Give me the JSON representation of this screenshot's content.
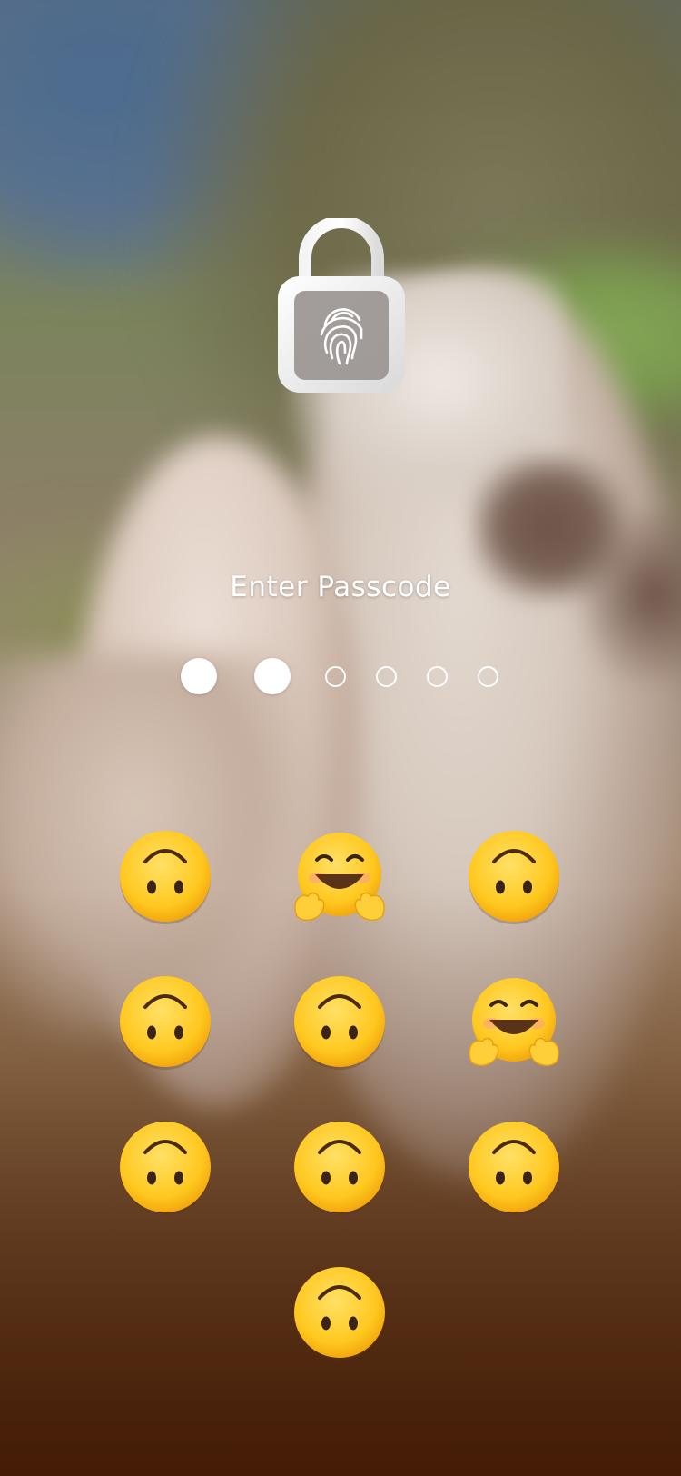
{
  "screen": {
    "title": "Enter Passcode"
  },
  "lock": {
    "icon": "fingerprint-unlocked-padlock-icon",
    "state": "unlocked"
  },
  "passcode": {
    "length": 6,
    "entered": 2
  },
  "keypad": {
    "keys": [
      {
        "emoji": "upside-down-face"
      },
      {
        "emoji": "hugging-face"
      },
      {
        "emoji": "upside-down-face"
      },
      {
        "emoji": "upside-down-face"
      },
      {
        "emoji": "upside-down-face"
      },
      {
        "emoji": "hugging-face"
      },
      {
        "emoji": "upside-down-face"
      },
      {
        "emoji": "upside-down-face"
      },
      {
        "emoji": "upside-down-face"
      },
      {
        "emoji": "upside-down-face"
      }
    ]
  },
  "colors": {
    "indicator": "#ffffff",
    "emoji_face": "#ffcc33"
  }
}
